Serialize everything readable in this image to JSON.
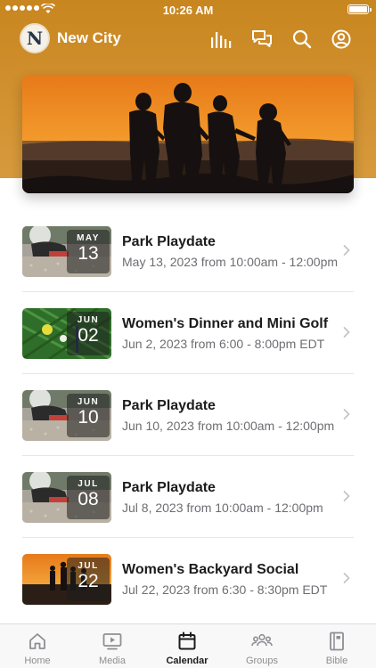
{
  "status_bar": {
    "time": "10:26 AM"
  },
  "app": {
    "name": "New City",
    "logo_letter": "N"
  },
  "header_icons": [
    "audio-bars-icon",
    "chat-icon",
    "search-icon",
    "profile-icon"
  ],
  "events": [
    {
      "month": "MAY",
      "day": "13",
      "title": "Park Playdate",
      "subtitle": "May 13, 2023 from 10:00am - 12:00pm",
      "thumb": "park"
    },
    {
      "month": "JUN",
      "day": "02",
      "title": "Women's Dinner and Mini Golf",
      "subtitle": "Jun 2, 2023 from 6:00 - 8:00pm EDT",
      "thumb": "golf"
    },
    {
      "month": "JUN",
      "day": "10",
      "title": "Park Playdate",
      "subtitle": "Jun 10, 2023 from 10:00am - 12:00pm",
      "thumb": "park"
    },
    {
      "month": "JUL",
      "day": "08",
      "title": "Park Playdate",
      "subtitle": "Jul 8, 2023 from 10:00am - 12:00pm",
      "thumb": "park"
    },
    {
      "month": "JUL",
      "day": "22",
      "title": "Women's Backyard Social",
      "subtitle": "Jul 22, 2023 from 6:30 - 8:30pm EDT",
      "thumb": "sunset"
    }
  ],
  "tabs": [
    {
      "label": "Home",
      "icon": "home-icon",
      "active": false
    },
    {
      "label": "Media",
      "icon": "media-icon",
      "active": false
    },
    {
      "label": "Calendar",
      "icon": "calendar-icon",
      "active": true
    },
    {
      "label": "Groups",
      "icon": "groups-icon",
      "active": false
    },
    {
      "label": "Bible",
      "icon": "bible-icon",
      "active": false
    }
  ],
  "colors": {
    "brand": "#c8861f",
    "active_tab": "#1c1c1e",
    "inactive_tab": "#8e8e93"
  }
}
